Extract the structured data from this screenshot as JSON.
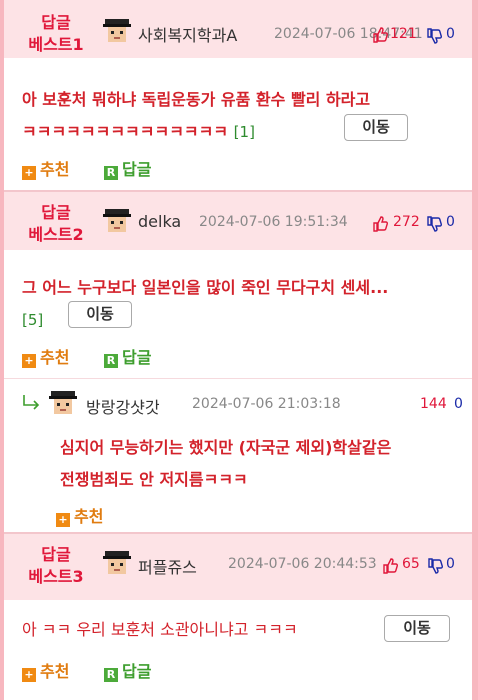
{
  "best_label": "답글\n베스트",
  "comments": [
    {
      "rank_line1": "답글",
      "rank_line2": "베스트1",
      "nickname": "사회복지학과A",
      "datetime": "2024-07-06 18:47:41",
      "upvotes": "121",
      "downvotes": "0",
      "text_line1": "아 보훈처 뭐하냐 독립운동가 유품 환수 빨리 하라고",
      "text_line2": "ㅋㅋㅋㅋㅋㅋㅋㅋㅋㅋㅋㅋㅋㅋ",
      "reply_ref": "[1]",
      "move_label": "이동",
      "recommend_label": "추천",
      "reply_label": "답글"
    },
    {
      "rank_line1": "답글",
      "rank_line2": "베스트2",
      "nickname": "delka",
      "datetime": "2024-07-06 19:51:34",
      "upvotes": "272",
      "downvotes": "0",
      "text_line1": "그 어느 누구보다 일본인을 많이 죽인 무다구치 센세...",
      "reply_ref": "[5]",
      "move_label": "이동",
      "recommend_label": "추천",
      "reply_label": "답글"
    },
    {
      "rank_line1": "답글",
      "rank_line2": "베스트3",
      "nickname": "퍼플쥬스",
      "datetime": "2024-07-06 20:44:53",
      "upvotes": "65",
      "downvotes": "0",
      "text_line1": "아 ㅋㅋ 우리 보훈처 소관아니냐고 ㅋㅋㅋ",
      "move_label": "이동",
      "recommend_label": "추천",
      "reply_label": "답글"
    }
  ],
  "sub_reply": {
    "nickname": "방랑강샷갓",
    "datetime": "2024-07-06 21:03:18",
    "upvotes": "144",
    "downvotes": "0",
    "text_line1": "심지어 무능하기는 했지만 (자국군 제외)학살같은",
    "text_line2": "전쟁범죄도 안 저지름ㅋㅋㅋ",
    "recommend_label": "추천"
  },
  "colors": {
    "accent_red": "#e0173a",
    "header_bg": "#fde3e6",
    "page_border": "#f7b7bf",
    "recommend_orange": "#f08a12",
    "reply_green": "#4caa3a",
    "downvote_blue": "#1a2aa8"
  },
  "icons": [
    "avatar-icon",
    "thumbs-up-icon",
    "thumbs-down-icon",
    "plus-icon",
    "reply-r-icon",
    "reply-arrow-icon"
  ]
}
